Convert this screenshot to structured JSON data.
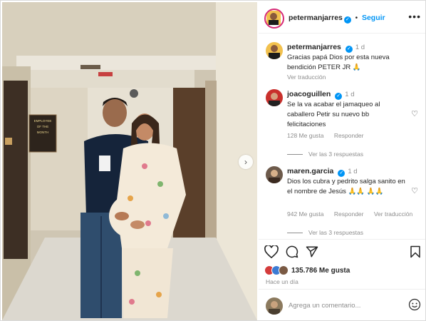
{
  "post": {
    "author": "petermanjarres",
    "follow_label": "Seguir",
    "more_label": "•••",
    "caption": {
      "username": "petermanjarres",
      "time": "1 d",
      "text": "Gracias papá Dios por esta nueva bendición PETER JR 🙏",
      "translate": "Ver traducción"
    }
  },
  "comments": [
    {
      "username": "joacoguillen",
      "time": "1 d",
      "text": "Se la va acabar el jamaqueo al caballero Petir su nuevo bb felicitaciones",
      "likes": "128 Me gusta",
      "reply": "Responder",
      "view_replies": "Ver las 3 respuestas"
    },
    {
      "username": "maren.garcia",
      "time": "1 d",
      "text": "Dios los cubra y pedrito salga sanito en el nombre de Jesús 🙏🙏 🙏🙏",
      "likes": "942 Me gusta",
      "reply": "Responder",
      "translate": "Ver traducción",
      "view_replies": "Ver las 3 respuestas"
    }
  ],
  "stats": {
    "likes": "135.786 Me gusta",
    "ago": "Hace un día"
  },
  "composer": {
    "placeholder": "Agrega un comentario..."
  },
  "photo": {
    "sign_text": "EMPLOYEE OF THE MONTH",
    "badge_text": "I"
  },
  "colors": {
    "accent": "#0095f6",
    "text": "#262626",
    "muted": "#8e8e8e"
  },
  "icons": [
    "heart-icon",
    "comment-icon",
    "share-icon",
    "bookmark-icon",
    "emoji-icon",
    "chevron-right-icon",
    "more-icon",
    "verified-icon"
  ]
}
